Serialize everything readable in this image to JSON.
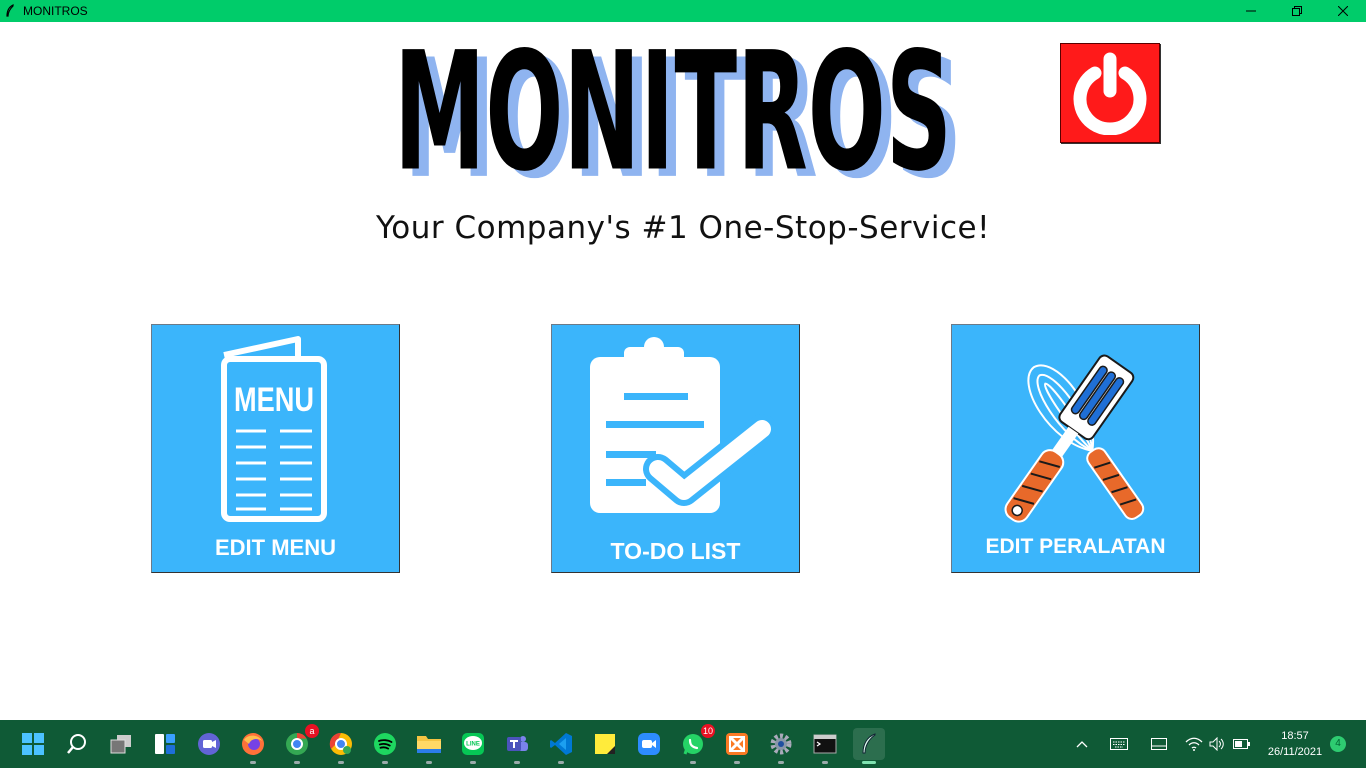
{
  "window": {
    "title": "MONITROS",
    "minimize_glyph": "—",
    "maximize_glyph": "❐",
    "close_glyph": "✕"
  },
  "header": {
    "logo_text": "MONITROS",
    "tagline": "Your Company's #1 One-Stop-Service!",
    "power_icon": "power-icon"
  },
  "tiles": [
    {
      "label": "EDIT MENU",
      "icon": "menu-card-icon",
      "icon_text": "MENU"
    },
    {
      "label": "TO-DO LIST",
      "icon": "clipboard-check-icon"
    },
    {
      "label": "EDIT PERALATAN",
      "icon": "spatula-whisk-icon"
    }
  ],
  "colors": {
    "titlebar": "#00cc6a",
    "tile_bg": "#3bb5fb",
    "power_bg": "#ff1a1a",
    "taskbar": "#0f5a36"
  },
  "taskbar": {
    "apps": [
      {
        "name": "start",
        "icon": "windows-start-icon"
      },
      {
        "name": "search",
        "icon": "search-icon"
      },
      {
        "name": "task-view",
        "icon": "task-view-icon"
      },
      {
        "name": "widgets",
        "icon": "widgets-icon"
      },
      {
        "name": "teams-chat",
        "icon": "video-chat-icon"
      },
      {
        "name": "firefox",
        "icon": "firefox-icon"
      },
      {
        "name": "chrome-profile",
        "icon": "chrome-profile-icon",
        "badge": "a"
      },
      {
        "name": "chrome",
        "icon": "chrome-icon"
      },
      {
        "name": "spotify",
        "icon": "spotify-icon"
      },
      {
        "name": "file-explorer",
        "icon": "folder-icon"
      },
      {
        "name": "line",
        "icon": "line-icon",
        "icon_text": "LINE"
      },
      {
        "name": "teams",
        "icon": "teams-icon"
      },
      {
        "name": "vscode",
        "icon": "vscode-icon"
      },
      {
        "name": "sticky-notes",
        "icon": "sticky-notes-icon"
      },
      {
        "name": "zoom",
        "icon": "zoom-icon"
      },
      {
        "name": "whatsapp",
        "icon": "whatsapp-icon",
        "badge": "10"
      },
      {
        "name": "xampp",
        "icon": "xampp-icon"
      },
      {
        "name": "settings",
        "icon": "gear-icon"
      },
      {
        "name": "terminal",
        "icon": "terminal-icon"
      },
      {
        "name": "monitros",
        "icon": "feather-icon"
      }
    ],
    "tray": {
      "time": "18:57",
      "date": "26/11/2021",
      "notifications": "4"
    }
  }
}
